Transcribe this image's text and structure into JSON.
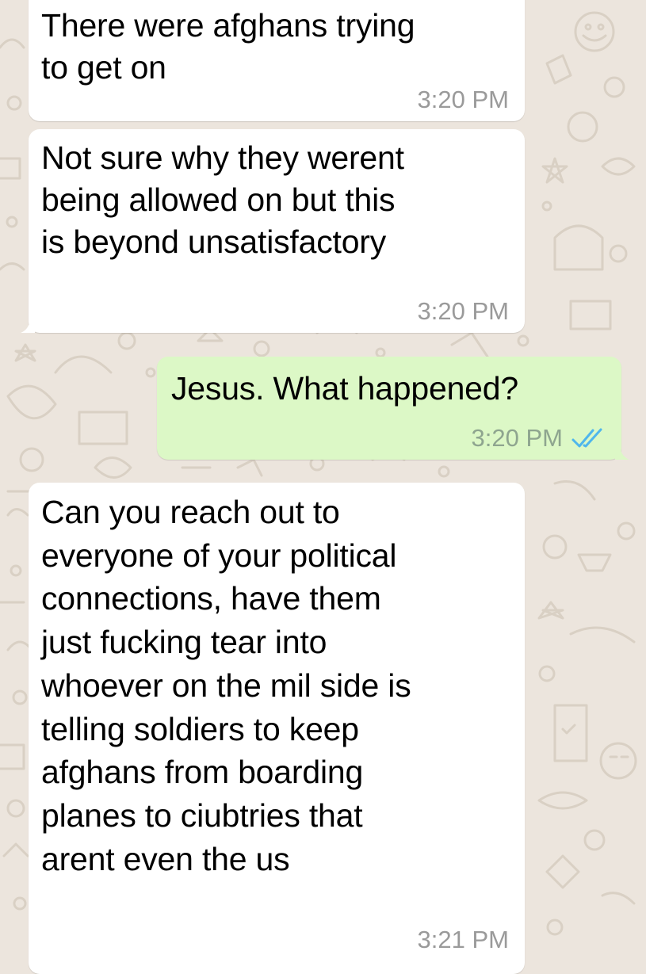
{
  "theme": {
    "wallpaper": "#ece5dd",
    "incoming_bubble": "#ffffff",
    "outgoing_bubble": "#dcf8c6",
    "timestamp": "#9a9a9a",
    "read_tick": "#4fb6ec"
  },
  "messages": [
    {
      "direction": "incoming",
      "text": "There were afghans trying\nto get on",
      "time": "3:20 PM"
    },
    {
      "direction": "incoming",
      "text": "Not sure why they werent\nbeing allowed on but this\nis beyond unsatisfactory",
      "time": "3:20 PM"
    },
    {
      "direction": "outgoing",
      "text": "Jesus. What happened?",
      "time": "3:20 PM",
      "status_icon": "double-check-read-icon"
    },
    {
      "direction": "incoming",
      "text": "Can you reach out to\neveryone of your political\nconnections, have them\njust fucking tear into\nwhoever on the mil side is\ntelling soldiers to keep\nafghans from boarding\nplanes to ciubtries that\narent even the us",
      "time": "3:21 PM"
    }
  ]
}
